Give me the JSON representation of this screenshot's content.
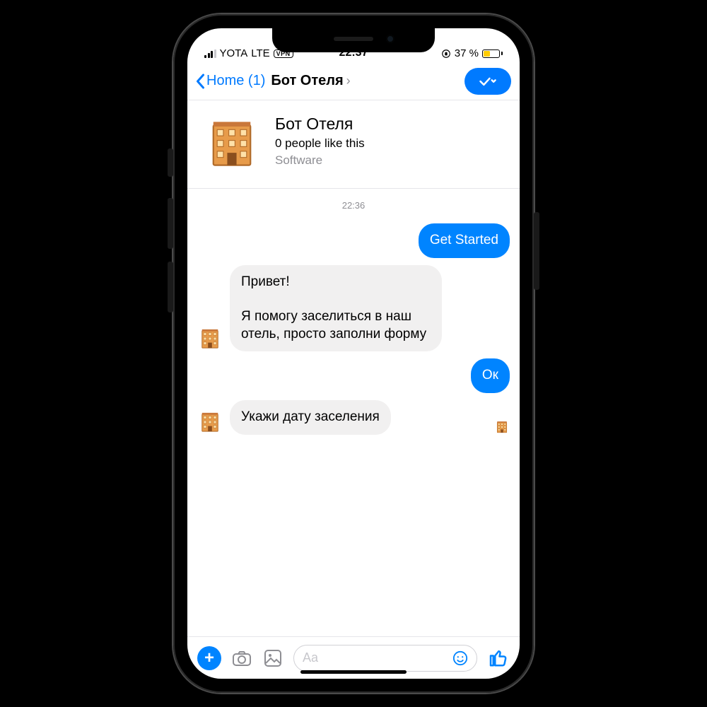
{
  "status": {
    "carrier": "YOTA",
    "network": "LTE",
    "vpn": "VPN",
    "time": "22:37",
    "battery_pct": "37 %"
  },
  "header": {
    "back_label": "Home (1)",
    "title": "Бот Отеля"
  },
  "profile": {
    "name": "Бот Отеля",
    "likes_line": "0 people like this",
    "category": "Software"
  },
  "chat": {
    "timestamp": "22:36",
    "messages": [
      {
        "side": "out",
        "text": "Get Started"
      },
      {
        "side": "in",
        "text": "Привет!\n\nЯ помогу заселиться в наш отель, просто заполни форму"
      },
      {
        "side": "out",
        "text": "Ок"
      },
      {
        "side": "in",
        "text": "Укажи дату заселения"
      }
    ]
  },
  "compose": {
    "placeholder": "Aa"
  }
}
